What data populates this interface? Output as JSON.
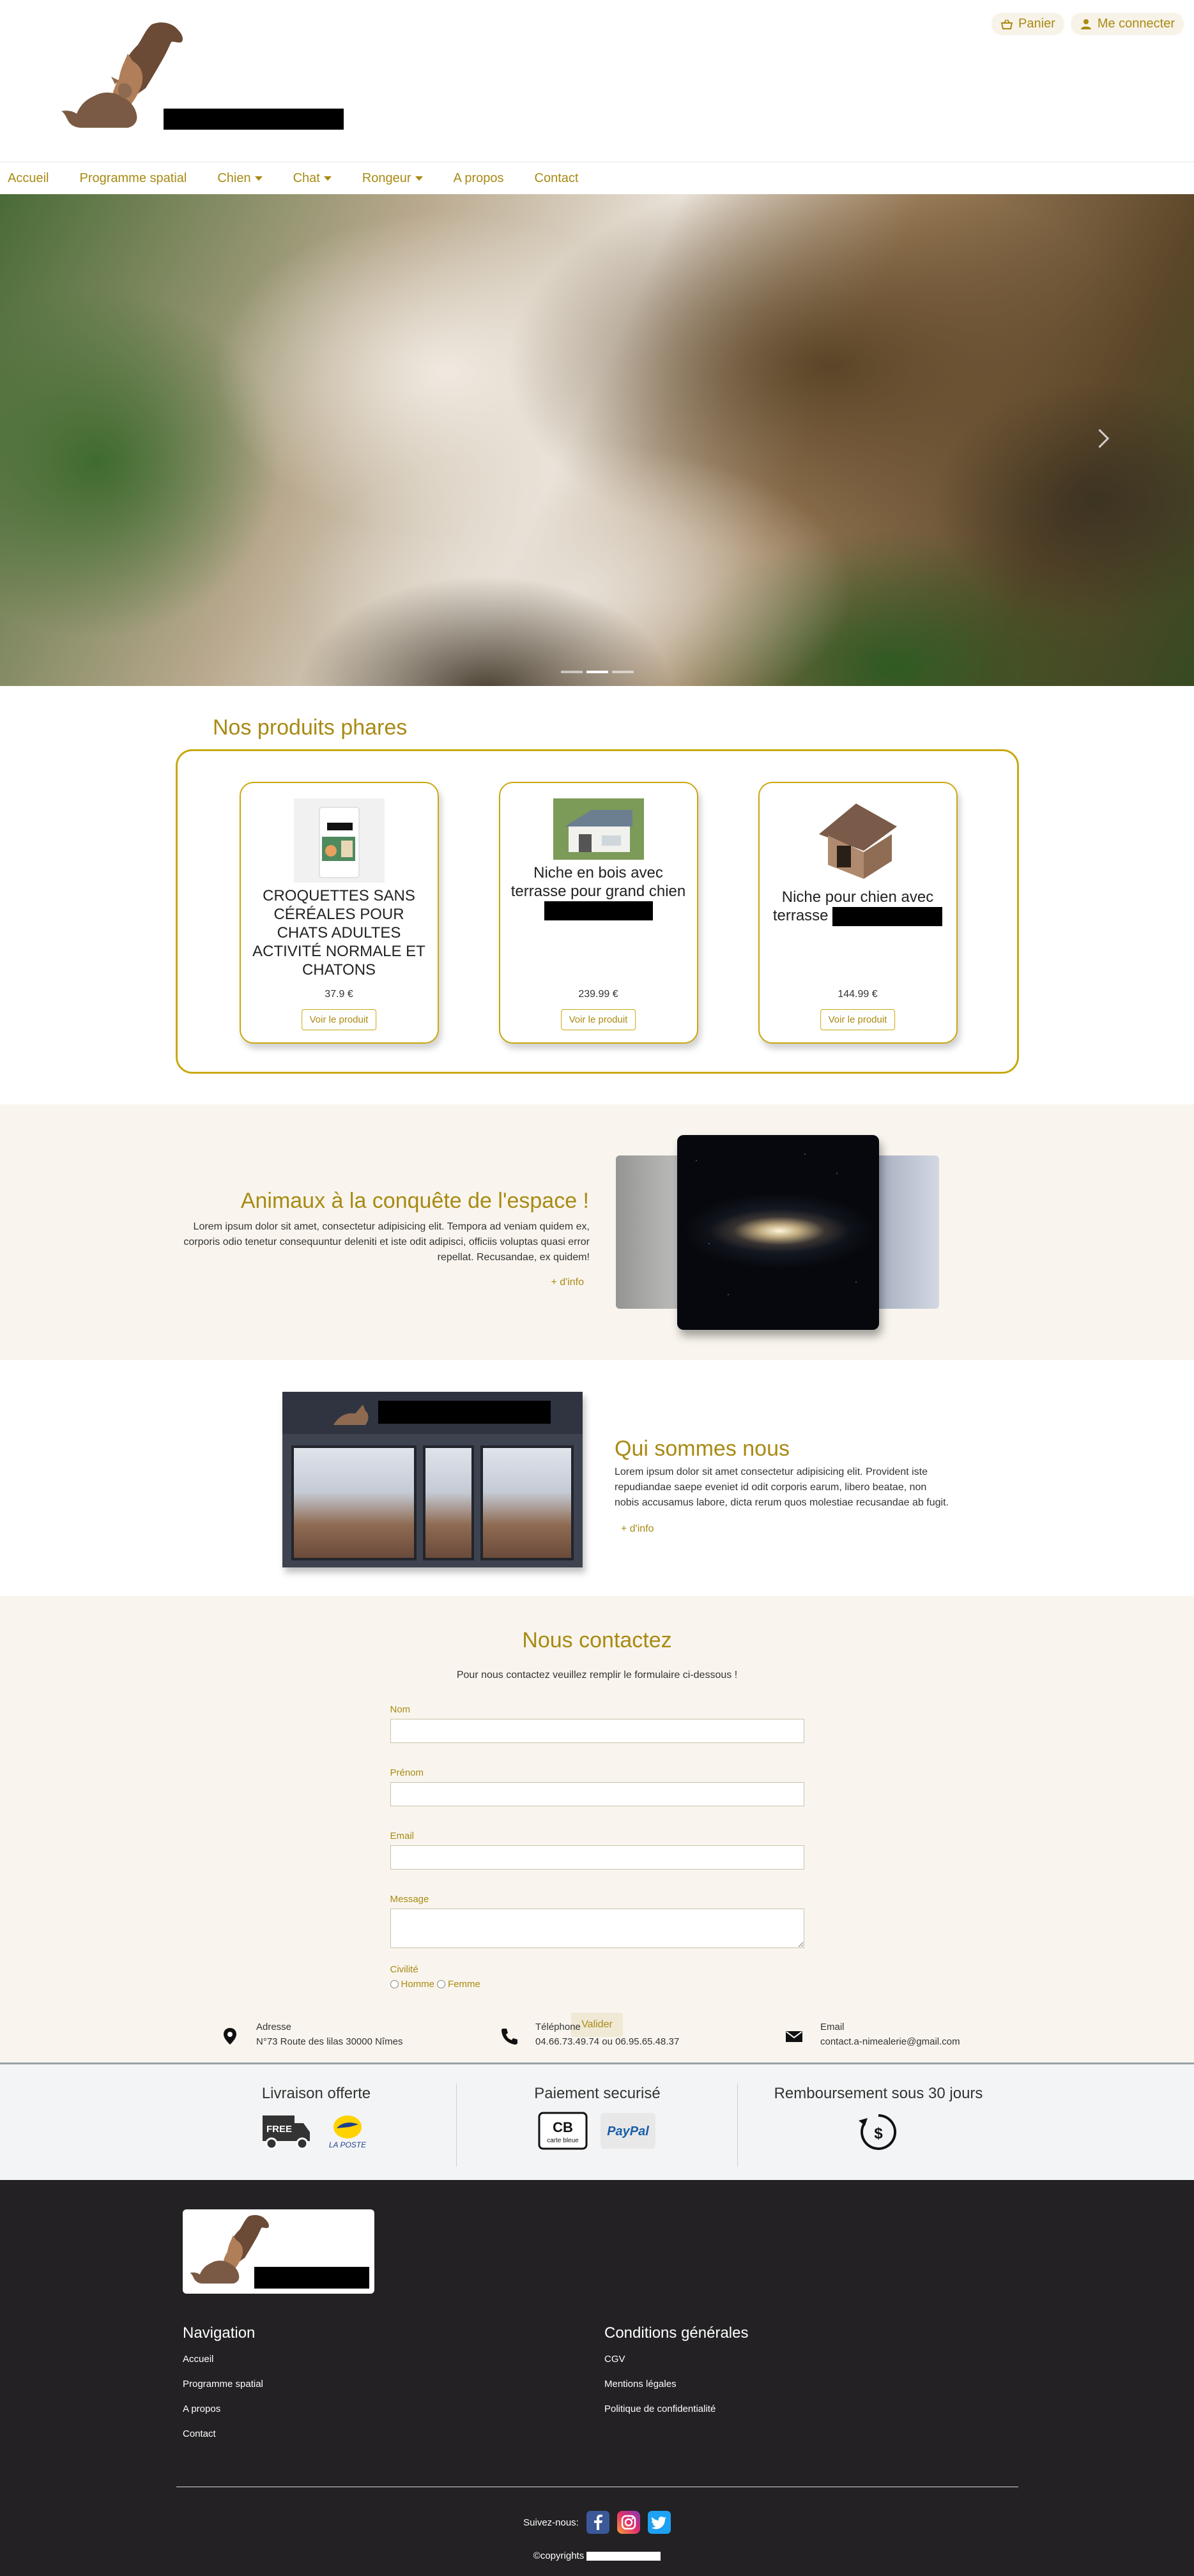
{
  "header": {
    "cart_label": "Panier",
    "login_label": "Me connecter"
  },
  "nav": {
    "items": [
      {
        "label": "Accueil"
      },
      {
        "label": "Programme spatial"
      },
      {
        "label": "Chien"
      },
      {
        "label": "Chat"
      },
      {
        "label": "Rongeur"
      },
      {
        "label": "A propos"
      },
      {
        "label": "Contact"
      }
    ]
  },
  "carousel": {
    "slide_count": 3,
    "active_slide": 2
  },
  "featured": {
    "title": "Nos produits phares",
    "products": [
      {
        "name": "CROQUETTES SANS CÉRÉALES POUR CHATS ADULTES ACTIVITÉ NORMALE ET CHATONS",
        "price": "37.9 €",
        "button": "Voir le produit"
      },
      {
        "name": "Niche en bois avec terrasse pour grand chien",
        "price": "239.99 €",
        "button": "Voir le produit"
      },
      {
        "name": "Niche pour chien avec terrasse",
        "price": "144.99 €",
        "button": "Voir le produit"
      }
    ]
  },
  "space": {
    "title": "Animaux à la conquête de l'espace !",
    "text": "Lorem ipsum dolor sit amet, consectetur adipisicing elit. Tempora ad veniam quidem ex, corporis odio tenetur consequuntur deleniti et iste odit adipisci, officiis voluptas quasi error repellat. Recusandae, ex quidem!",
    "more": "+ d'info"
  },
  "about": {
    "title": "Qui sommes nous",
    "text": "Lorem ipsum dolor sit amet consectetur adipisicing elit. Provident iste repudiandae saepe eveniet id odit corporis earum, libero beatae, non nobis accusamus labore, dicta rerum quos molestiae recusandae ab fugit.",
    "more": "+ d'info"
  },
  "contact": {
    "title": "Nous contactez",
    "intro": "Pour nous contactez veuillez remplir le formulaire ci-dessous !",
    "fields": {
      "nom": "Nom",
      "prenom": "Prénom",
      "email": "Email",
      "message": "Message"
    },
    "civilite": {
      "label": "Civilité",
      "options": [
        "Homme",
        "Femme"
      ]
    },
    "submit": "Valider",
    "info": {
      "address_label": "Adresse",
      "address": "N°73 Route des lilas 30000 Nîmes",
      "phone_label": "Téléphone",
      "phone": "04.66.73.49.74 ou 06.95.65.48.37",
      "email_label": "Email",
      "email": "contact.a-nimealerie@gmail.com"
    }
  },
  "guarantees": {
    "delivery": "Livraison offerte",
    "payment": "Paiement securisé",
    "refund": "Remboursement sous 30 jours",
    "free_badge": "FREE",
    "laposte": "LA POSTE",
    "cb": "CB",
    "cb_sub": "carte bleue",
    "paypal": "PayPal"
  },
  "footer": {
    "nav_title": "Navigation",
    "nav_links": [
      "Accueil",
      "Programme spatial",
      "A propos",
      "Contact"
    ],
    "cond_title": "Conditions générales",
    "cond_links": [
      "CGV",
      "Mentions légales",
      "Politique de confidentialité"
    ],
    "follow": "Suivez-nous:",
    "copyright": "©copyrights"
  },
  "colors": {
    "accent": "#a88a14",
    "accent_border": "#c9a80f",
    "cream": "#f9f5ee",
    "footer_bg": "#232123",
    "logo_brown": "#7a5a44"
  }
}
